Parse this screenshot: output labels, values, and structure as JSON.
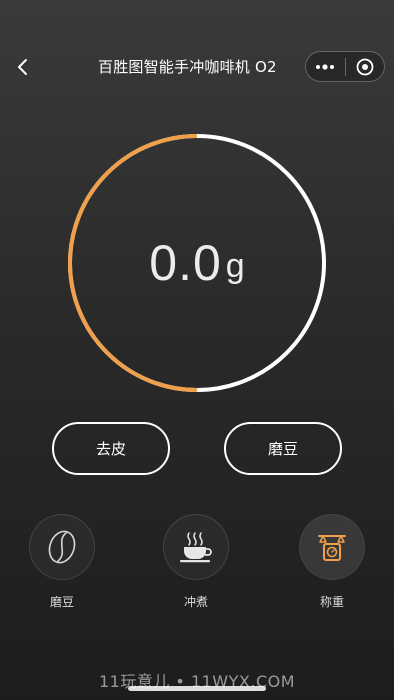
{
  "header": {
    "title": "百胜图智能手冲咖啡机 O2"
  },
  "scale": {
    "value": "0.0",
    "unit": "g",
    "progress_fraction": 0.5,
    "colors": {
      "progress": "#f0a04b",
      "track": "#ffffff"
    }
  },
  "actions": {
    "tare_label": "去皮",
    "grind_label": "磨豆"
  },
  "tabs": [
    {
      "label": "磨豆",
      "icon": "coffee-bean-icon",
      "active": false
    },
    {
      "label": "冲煮",
      "icon": "coffee-cup-icon",
      "active": false
    },
    {
      "label": "称重",
      "icon": "scale-icon",
      "active": true
    }
  ],
  "tab_active_color": "#f0a04b",
  "watermark": "11玩意儿 • 11WYX.COM"
}
